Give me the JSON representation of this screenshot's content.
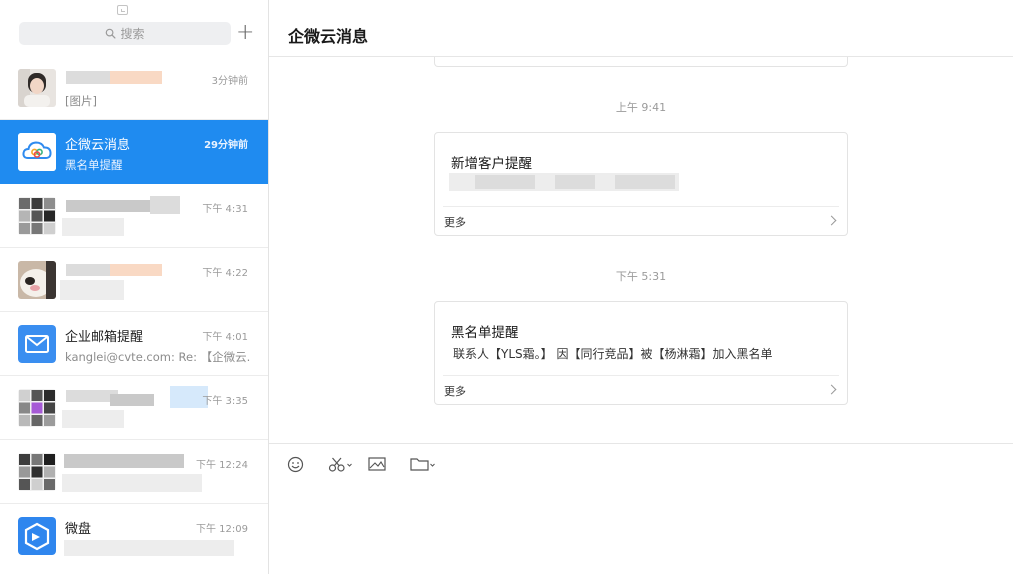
{
  "sidebar": {
    "search": {
      "placeholder": "搜索"
    },
    "add_label": "+",
    "conversations": [
      {
        "name": "",
        "preview": "[图片]",
        "time": "3分钟前",
        "active": false,
        "avatar": "user-photo"
      },
      {
        "name": "企微云消息",
        "preview": "黑名单提醒",
        "time": "29分钟前",
        "active": true,
        "avatar": "qiweiyun-cloud-icon"
      },
      {
        "name": "",
        "preview": "",
        "time": "下午 4:31",
        "active": false,
        "avatar": "group-avatar-grid"
      },
      {
        "name": "",
        "preview": "",
        "time": "下午 4:22",
        "active": false,
        "avatar": "dog-photo"
      },
      {
        "name": "企业邮箱提醒",
        "preview": "kanglei@cvte.com: Re: 【企微云...",
        "time": "下午 4:01",
        "active": false,
        "avatar": "mail-envelope-icon"
      },
      {
        "name": "",
        "preview": "",
        "time": "下午 3:35",
        "active": false,
        "avatar": "group-avatar-grid"
      },
      {
        "name": "",
        "preview": "",
        "time": "下午 12:24",
        "active": false,
        "avatar": "group-avatar-grid"
      },
      {
        "name": "微盘",
        "preview": "",
        "time": "下午 12:09",
        "active": false,
        "avatar": "weipan-box-icon"
      }
    ]
  },
  "chat": {
    "title": "企微云消息",
    "timestamps": [
      "上午 9:41",
      "下午 5:31"
    ],
    "cards": [
      {
        "title": "新增客户提醒",
        "body": "",
        "more": "更多"
      },
      {
        "title": "黑名单提醒",
        "body": "联系人【YLS霜。】 因【同行竞品】被【杨淋霜】加入黑名单",
        "more": "更多"
      }
    ]
  },
  "toolbar": {
    "tools": [
      "emoji-icon",
      "scissors-icon",
      "image-icon",
      "folder-icon"
    ]
  },
  "colors": {
    "accent": "#1f8bf0",
    "mail_blue": "#3a8ef0"
  }
}
